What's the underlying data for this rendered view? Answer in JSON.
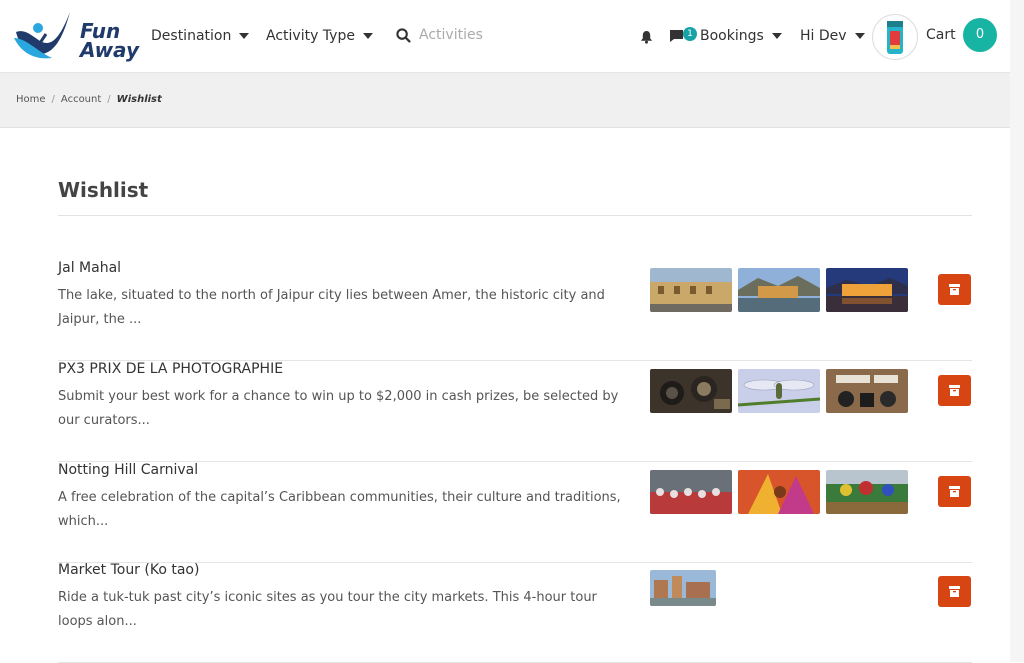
{
  "brand": {
    "line1": "Fun",
    "line2": "Away"
  },
  "nav": {
    "destination": "Destination",
    "activity_type": "Activity Type",
    "search_label": "Activities",
    "bookings": "Bookings",
    "bookings_badge": "1",
    "greeting": "Hi Dev",
    "cart": "Cart",
    "cart_count": "0"
  },
  "breadcrumb": {
    "home": "Home",
    "account": "Account",
    "current": "Wishlist"
  },
  "page": {
    "title": "Wishlist"
  },
  "items": [
    {
      "title": "Jal Mahal",
      "desc": "The lake, situated to the north of Jaipur city lies between Amer, the historic city and Jaipur, the ...",
      "images": [
        "palace-courtyard",
        "palace-on-lake-day",
        "palace-on-lake-night"
      ]
    },
    {
      "title": "PX3 PRIX DE LA PHOTOGRAPHIE",
      "desc": "Submit your best work for a chance to win up to $2,000 in cash prizes, be selected by our curators...",
      "images": [
        "camera-lenses",
        "insect-macro",
        "camera-gear-flatlay"
      ]
    },
    {
      "title": "Notting Hill Carnival",
      "desc": " A free celebration of the capital’s Caribbean communities, their culture and traditions, which...",
      "images": [
        "carnival-parade-crowd",
        "carnival-costume",
        "carnival-float"
      ]
    },
    {
      "title": "Market Tour (Ko tao)",
      "desc": "Ride a tuk-tuk past city’s iconic sites as you tour the city markets. This 4-hour tour loops alon...",
      "images": [
        "city-square"
      ]
    }
  ],
  "colors": {
    "accent": "#17b3a3",
    "delete": "#d64512",
    "brand": "#1f3a6b"
  }
}
